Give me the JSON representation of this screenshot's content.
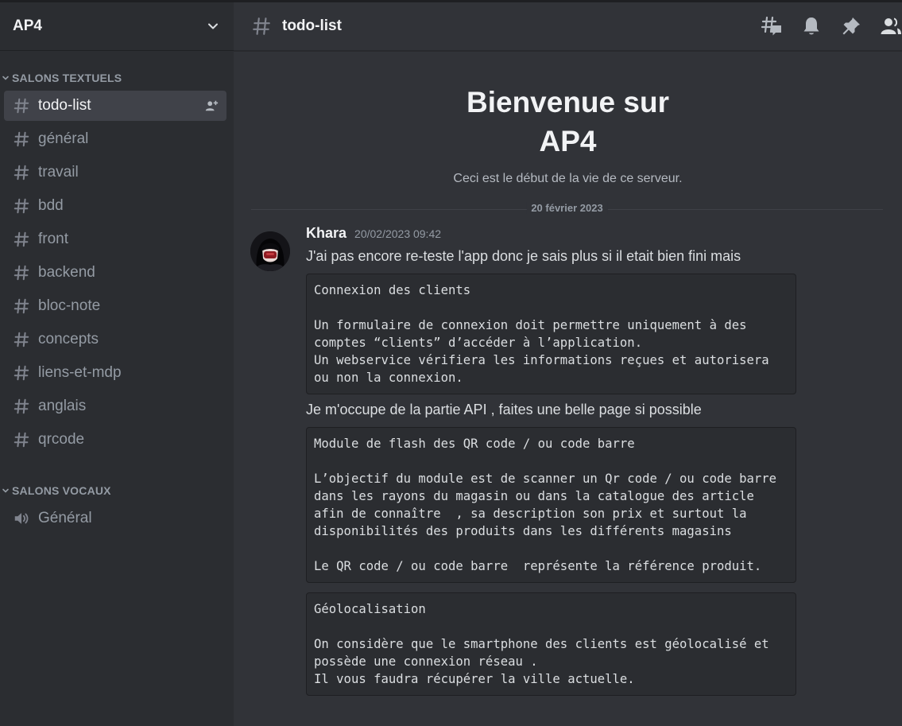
{
  "server": {
    "name": "AP4"
  },
  "sidebar": {
    "categories": [
      {
        "label": "SALONS TEXTUELS"
      },
      {
        "label": "SALONS VOCAUX"
      }
    ],
    "text_channels": [
      {
        "label": "todo-list",
        "active": true
      },
      {
        "label": "général"
      },
      {
        "label": "travail"
      },
      {
        "label": "bdd"
      },
      {
        "label": "front"
      },
      {
        "label": "backend"
      },
      {
        "label": "bloc-note"
      },
      {
        "label": "concepts"
      },
      {
        "label": "liens-et-mdp"
      },
      {
        "label": "anglais"
      },
      {
        "label": "qrcode"
      }
    ],
    "voice_channels": [
      {
        "label": "Général"
      }
    ]
  },
  "channel": {
    "title": "todo-list"
  },
  "toolbar_icons": [
    "threads-icon",
    "bell-icon",
    "pin-icon",
    "members-icon"
  ],
  "welcome": {
    "line1": "Bienvenue sur",
    "line2": "AP4",
    "subtitle": "Ceci est le début de la vie de ce serveur."
  },
  "date_divider": "20 février 2023",
  "message": {
    "author": "Khara",
    "timestamp": "20/02/2023 09:42",
    "text1": "J'ai pas encore re-teste l'app donc je sais plus si il etait bien fini mais",
    "code1": "Connexion des clients\n\nUn formulaire de connexion doit permettre uniquement à des comptes “clients” d’accéder à l’application.\nUn webservice vérifiera les informations reçues et autorisera ou non la connexion.",
    "text2": "Je m'occupe de la partie API , faites une belle page si possible",
    "code2": "Module de flash des QR code / ou code barre\n\nL’objectif du module est de scanner un Qr code / ou code barre dans les rayons du magasin ou dans la catalogue des article afin de connaître  , sa description son prix et surtout la disponibilités des produits dans les différents magasins\n\nLe QR code / ou code barre  représente la référence produit.",
    "code3": "Géolocalisation\n\nOn considère que le smartphone des clients est géolocalisé et possède une connexion réseau .\nIl vous faudra récupérer la ville actuelle."
  },
  "colors": {
    "sidebar_bg": "#2b2d31",
    "main_bg": "#313338",
    "active_channel_bg": "#404249",
    "muted_text": "#949ba4",
    "bright_text": "#f2f3f5"
  }
}
